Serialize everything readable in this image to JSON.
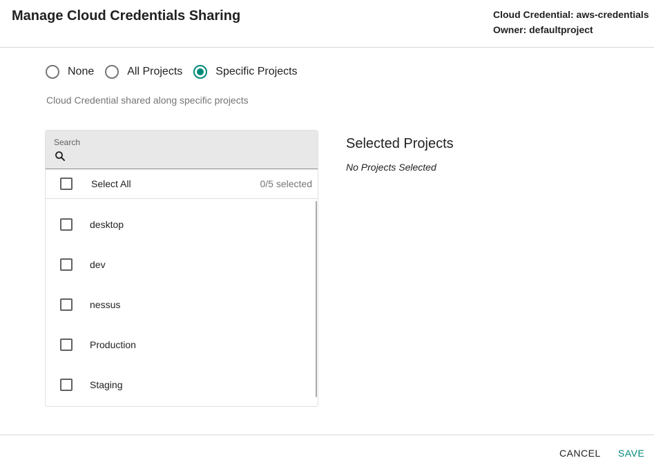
{
  "header": {
    "title": "Manage Cloud Credentials Sharing",
    "credential": "Cloud Credential: aws-credentials",
    "owner": "Owner: defaultproject"
  },
  "sharing": {
    "options": [
      {
        "label": "None",
        "checked": false
      },
      {
        "label": "All Projects",
        "checked": false
      },
      {
        "label": "Specific Projects",
        "checked": true
      }
    ],
    "hint": "Cloud Credential shared along specific projects",
    "accent_color": "#00897b"
  },
  "project_list": {
    "search_label": "Search",
    "search_value": "",
    "search_icon": "search-icon",
    "select_all_label": "Select All",
    "count_text": "0/5 selected",
    "items": [
      {
        "label": "desktop",
        "checked": false
      },
      {
        "label": "dev",
        "checked": false
      },
      {
        "label": "nessus",
        "checked": false
      },
      {
        "label": "Production",
        "checked": false
      },
      {
        "label": "Staging",
        "checked": false
      }
    ]
  },
  "selected_projects": {
    "title": "Selected Projects",
    "empty_text": "No Projects Selected"
  },
  "footer": {
    "cancel_label": "CANCEL",
    "save_label": "SAVE"
  }
}
